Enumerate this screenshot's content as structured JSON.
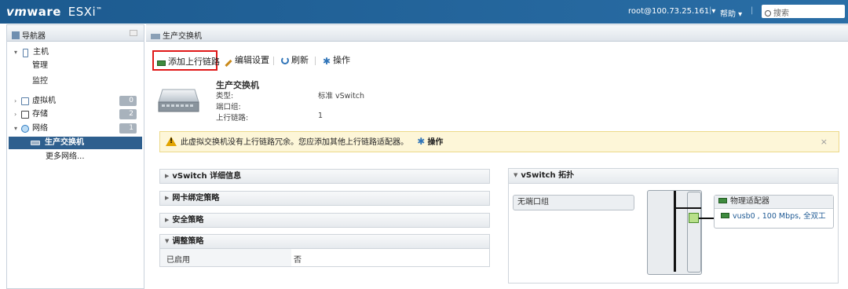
{
  "header": {
    "logo_vm": "vm",
    "logo_ware": "ware",
    "logo_product": "ESXi",
    "logo_mark": "™",
    "user": "root@100.73.25.161 ▾",
    "separator": "|",
    "help": "帮助 ▾",
    "search_placeholder": "搜索"
  },
  "navigator": {
    "title": "导航器",
    "items": [
      {
        "label": "主机",
        "toggle": "▾",
        "badge": ""
      },
      {
        "label": "管理"
      },
      {
        "label": "监控"
      },
      {
        "label": "虚拟机",
        "toggle": "›",
        "badge": "0"
      },
      {
        "label": "存储",
        "toggle": "›",
        "badge": "2"
      },
      {
        "label": "网络",
        "toggle": "▾",
        "badge": "1"
      },
      {
        "label": "生产交换机"
      },
      {
        "label": "更多网络..."
      }
    ]
  },
  "main": {
    "title": "生产交换机",
    "toolbar": {
      "add_uplink": "添加上行链路",
      "edit_settings": "编辑设置",
      "refresh": "刷新",
      "actions": "操作"
    },
    "info": {
      "name": "生产交换机",
      "type_label": "类型:",
      "type_value": "标准 vSwitch",
      "portgroup_label": "端口组:",
      "uplinks_label": "上行链路:",
      "uplinks_value": "1"
    },
    "alert": {
      "text": "此虚拟交换机没有上行链路冗余。您应添加其他上行链路适配器。",
      "action": "操作",
      "close": "×"
    },
    "sections": {
      "details": "vSwitch 详细信息",
      "nic_teaming": "网卡绑定策略",
      "security": "安全策略",
      "shaping": "调整策略",
      "shaping_enabled_label": "已启用",
      "shaping_enabled_value": "否",
      "topology": "vSwitch 拓扑"
    },
    "topology": {
      "no_portgroup": "无端口组",
      "adapter_header": "物理适配器",
      "adapter_row": "vusb0 , 100 Mbps, 全双工"
    }
  }
}
